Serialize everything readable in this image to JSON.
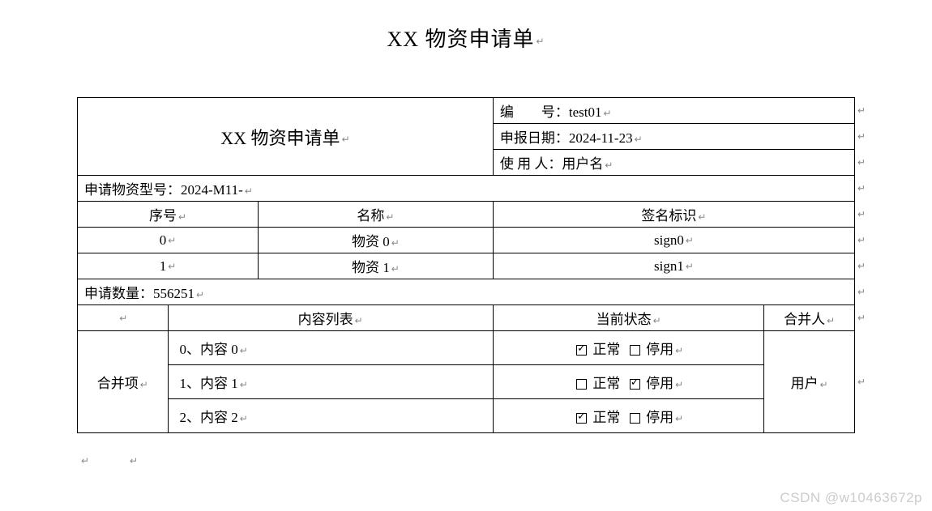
{
  "page_title": "XX 物资申请单",
  "header": {
    "form_title": "XX 物资申请单",
    "number_label": "编　　号：",
    "number_value": "test01",
    "date_label": "申报日期：",
    "date_value": "2024-11-23",
    "user_label": "使 用 人：",
    "user_value": "用户名"
  },
  "model_line_label": "申请物资型号：",
  "model_line_value": "2024-M11-",
  "cols1": {
    "seq": "序号",
    "name": "名称",
    "sign": "签名标识"
  },
  "items": [
    {
      "seq": "0",
      "name": "物资 0",
      "sign": "sign0"
    },
    {
      "seq": "1",
      "name": "物资 1",
      "sign": "sign1"
    }
  ],
  "qty_label": "申请数量：",
  "qty_value": "556251",
  "cols2": {
    "c1": "",
    "c2": "内容列表",
    "c3": "当前状态",
    "c4": "合并人"
  },
  "merge_label": "合并项",
  "merge_user": "用户",
  "status_normal": "正常",
  "status_disabled": "停用",
  "contents": [
    {
      "text": "0、内容 0",
      "normal": true,
      "disabled": false
    },
    {
      "text": "1、内容 1",
      "normal": false,
      "disabled": true
    },
    {
      "text": "2、内容 2",
      "normal": true,
      "disabled": false
    }
  ],
  "watermark": "CSDN @w10463672p",
  "para_glyph": "↵"
}
